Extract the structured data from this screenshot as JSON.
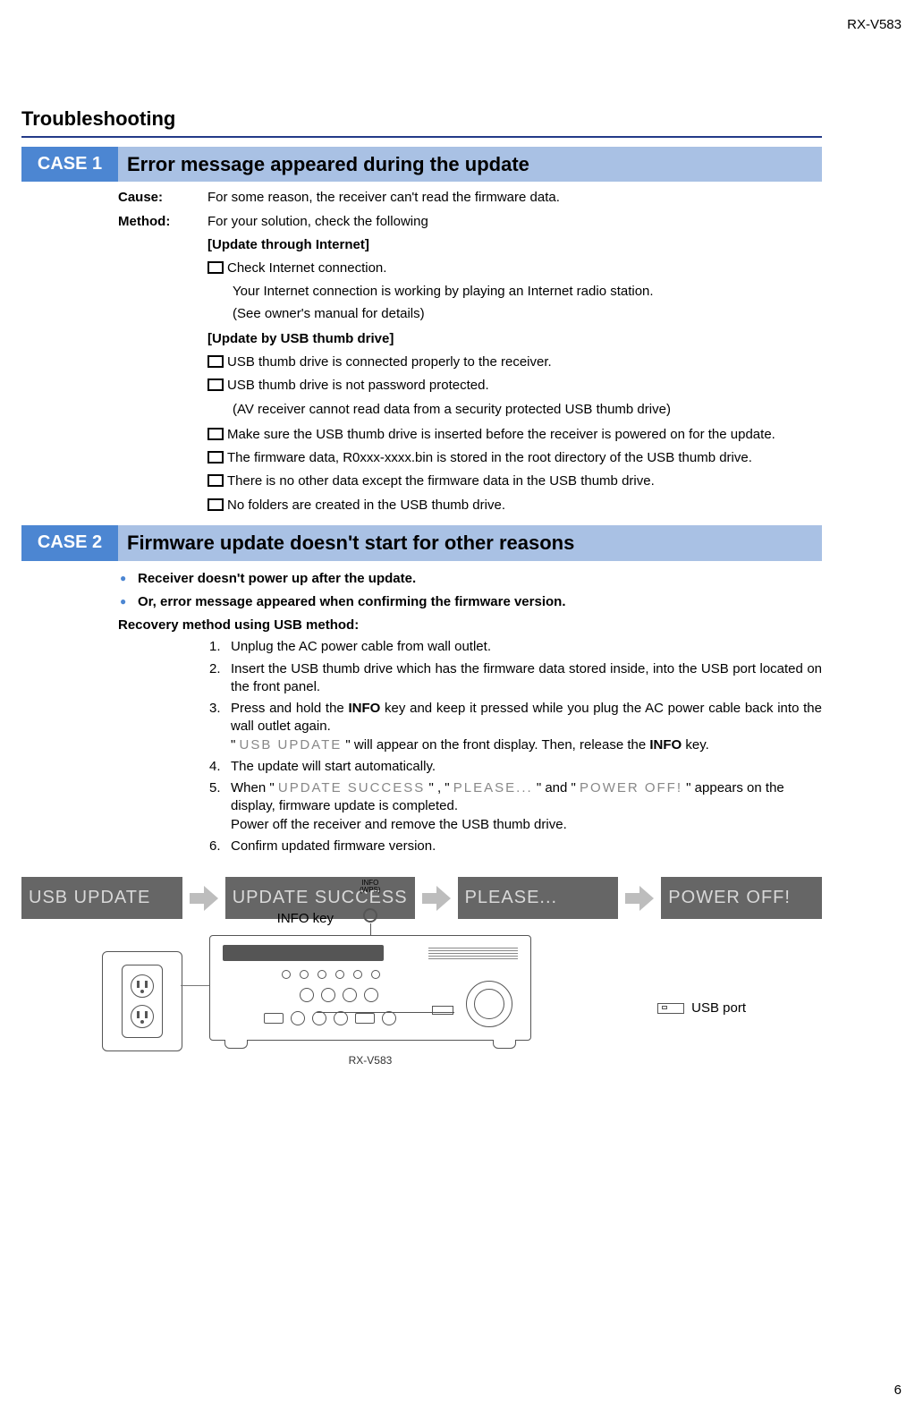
{
  "model_code": "RX-V583",
  "page_number": "6",
  "heading": "Troubleshooting",
  "case1": {
    "label": "CASE 1",
    "title": "Error message appeared during the update",
    "cause_key": "Cause:",
    "cause_val": "For some reason, the receiver can't read the firmware data.",
    "method_key": "Method:",
    "method_val": "For your solution, check the following",
    "internet_head": "[Update through Internet]",
    "internet_check1": "Check Internet connection.",
    "internet_sub1": "Your Internet connection is working by playing an Internet radio station.",
    "internet_sub2": "(See owner's manual for details)",
    "usb_head": "[Update by USB thumb drive]",
    "usb_check1": "USB thumb drive is connected properly to the receiver.",
    "usb_check2": "USB thumb drive is not password protected.",
    "usb_sub1": "(AV receiver cannot read data from a security protected USB thumb drive)",
    "usb_check3": "Make sure the USB thumb drive is inserted before the receiver is powered on for the update.",
    "usb_check4": "The firmware data, R0xxx-xxxx.bin is stored in the root directory of the USB thumb drive.",
    "usb_check5": "There is no other data except the firmware data in the USB thumb drive.",
    "usb_check6": "No folders are created in the USB thumb drive."
  },
  "case2": {
    "label": "CASE 2",
    "title": "Firmware update doesn't start for other reasons",
    "bullet1": "Receiver doesn't power up after the update.",
    "bullet2": "Or, error message appeared when confirming the firmware version.",
    "recovery_head": "Recovery method using USB method:",
    "step1_num": "1.",
    "step1": "Unplug the AC power cable from wall outlet.",
    "step2_num": "2.",
    "step2": "Insert the USB thumb drive which has the firmware data stored inside, into the USB port located on the front panel.",
    "step3_num": "3.",
    "step3_a": "Press and hold the ",
    "step3_info": "INFO",
    "step3_b": " key and keep it pressed while you plug the AC power cable back into the wall outlet again.",
    "step3_c1": "\" ",
    "step3_seg1": "USB UPDATE",
    "step3_c2": " \" will appear on the front display. Then, release the ",
    "step3_info2": "INFO",
    "step3_c3": " key.",
    "step4_num": "4.",
    "step4": "The update will start automatically.",
    "step5_num": "5.",
    "step5_a": "When \" ",
    "step5_seg1": "UPDATE SUCCESS",
    "step5_b": " \" , \" ",
    "step5_seg2": "PLEASE...",
    "step5_c": " \" and \" ",
    "step5_seg3": "POWER OFF!",
    "step5_d": " \" appears on the display, firmware update is completed.",
    "step5_e": "Power off the receiver and remove the USB thumb drive.",
    "step6_num": "6.",
    "step6": "Confirm updated firmware version."
  },
  "displays": {
    "d1": "USB UPDATE",
    "d2": "UPDATE SUCCESS",
    "d3": "PLEASE...",
    "d4": "POWER OFF!"
  },
  "device": {
    "info_key_label": "INFO key",
    "usb_port_label": "USB port",
    "model_under": "RX-V583",
    "info_top1": "INFO",
    "info_top2": "(WPS)"
  }
}
